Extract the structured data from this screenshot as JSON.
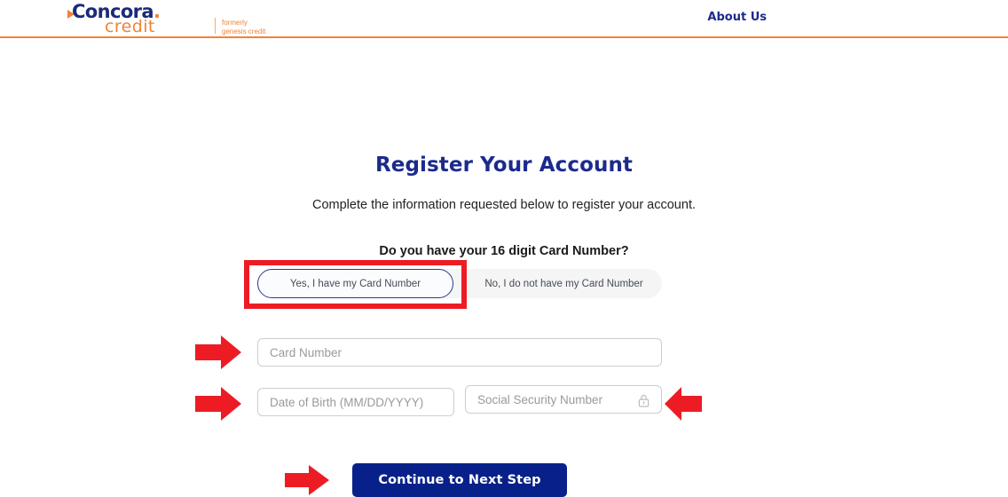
{
  "header": {
    "logo": {
      "brand": "Concora",
      "brand_dot": ".",
      "product": "credit",
      "tagline": "formerly\ngenesis credit",
      "triangle_icon": "play-triangle-icon"
    },
    "nav": {
      "about_us": "About Us"
    },
    "divider_color": "#ef8337",
    "brand_color": "#1b2a7a",
    "accent_color": "#ef8337"
  },
  "main": {
    "page_title": "Register Your Account",
    "subtitle": "Complete the information requested below to register your account.",
    "question": "Do you have your 16 digit Card Number?",
    "toggle": {
      "selected_index": 0,
      "options": [
        {
          "label": "Yes, I have my Card Number",
          "selected": true
        },
        {
          "label": "No, I do not have my Card Number",
          "selected": false
        }
      ],
      "selected_border_color": "#2b3990",
      "track_color": "#f5f5f5"
    },
    "fields": {
      "card_number": {
        "placeholder": "Card Number",
        "value": ""
      },
      "date_of_birth": {
        "placeholder": "Date of Birth (MM/DD/YYYY)",
        "value": ""
      },
      "social_security_number": {
        "placeholder": "Social Security Number",
        "value": "",
        "icon": "lock-icon"
      }
    },
    "submit_button": {
      "label": "Continue to Next Step",
      "background_color": "#08218a",
      "text_color": "#ffffff"
    }
  },
  "annotations": {
    "color": "#ed1c24",
    "highlight_box_target": "yes-i-have-my-card-number-toggle",
    "arrows": [
      {
        "name": "arrow-to-card-number-field",
        "direction": "right"
      },
      {
        "name": "arrow-to-date-of-birth-field",
        "direction": "right"
      },
      {
        "name": "arrow-to-social-security-number-field",
        "direction": "left"
      },
      {
        "name": "arrow-to-continue-button",
        "direction": "right"
      }
    ]
  }
}
